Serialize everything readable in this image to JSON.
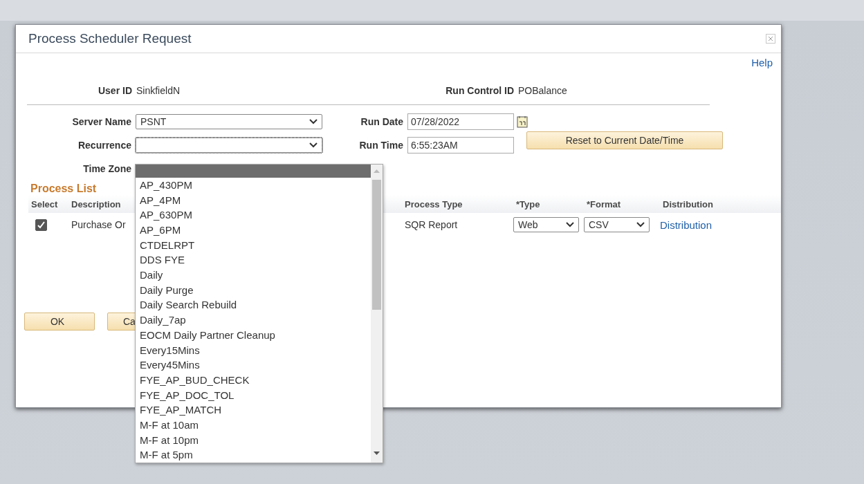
{
  "dialog": {
    "title": "Process Scheduler Request",
    "help": "Help",
    "user_id": {
      "label": "User ID",
      "value": "SinkfieldN"
    },
    "run_control_id": {
      "label": "Run Control ID",
      "value": "POBalance"
    },
    "server_name": {
      "label": "Server Name",
      "value": "PSNT"
    },
    "recurrence": {
      "label": "Recurrence",
      "open": true,
      "blank_selected": true,
      "options": [
        {
          "label": "AP_430PM",
          "selected": false
        },
        {
          "label": "AP_4PM",
          "selected": false
        },
        {
          "label": "AP_630PM",
          "selected": false
        },
        {
          "label": "AP_6PM",
          "selected": false
        },
        {
          "label": "CTDELRPT",
          "selected": false
        },
        {
          "label": "DDS FYE",
          "selected": false
        },
        {
          "label": "Daily",
          "selected": false
        },
        {
          "label": "Daily Purge",
          "selected": false
        },
        {
          "label": "Daily Search Rebuild",
          "selected": false
        },
        {
          "label": "Daily_7ap",
          "selected": false
        },
        {
          "label": "EOCM Daily Partner Cleanup",
          "selected": false
        },
        {
          "label": "Every15Mins",
          "selected": false
        },
        {
          "label": "Every45Mins",
          "selected": false
        },
        {
          "label": "FYE_AP_BUD_CHECK",
          "selected": false
        },
        {
          "label": "FYE_AP_DOC_TOL",
          "selected": false
        },
        {
          "label": "FYE_AP_MATCH",
          "selected": false
        },
        {
          "label": "M-F at 10am",
          "selected": false
        },
        {
          "label": "M-F at 10pm",
          "selected": false
        },
        {
          "label": "M-F at 5pm",
          "selected": false
        }
      ]
    },
    "time_zone": {
      "label": "Time Zone"
    },
    "run_date": {
      "label": "Run Date",
      "value": "07/28/2022"
    },
    "run_time": {
      "label": "Run Time",
      "value": "6:55:23AM"
    },
    "reset_button": "Reset to Current Date/Time",
    "process_list": {
      "title": "Process List",
      "columns": [
        "Select",
        "Description",
        "Process Type",
        "*Type",
        "*Format",
        "Distribution"
      ],
      "rows": [
        {
          "checked": true,
          "description": "Purchase Or",
          "process_type": "SQR Report",
          "type": "Web",
          "format": "CSV",
          "distribution": "Distribution"
        }
      ]
    },
    "buttons": [
      "OK",
      "Ca"
    ]
  }
}
